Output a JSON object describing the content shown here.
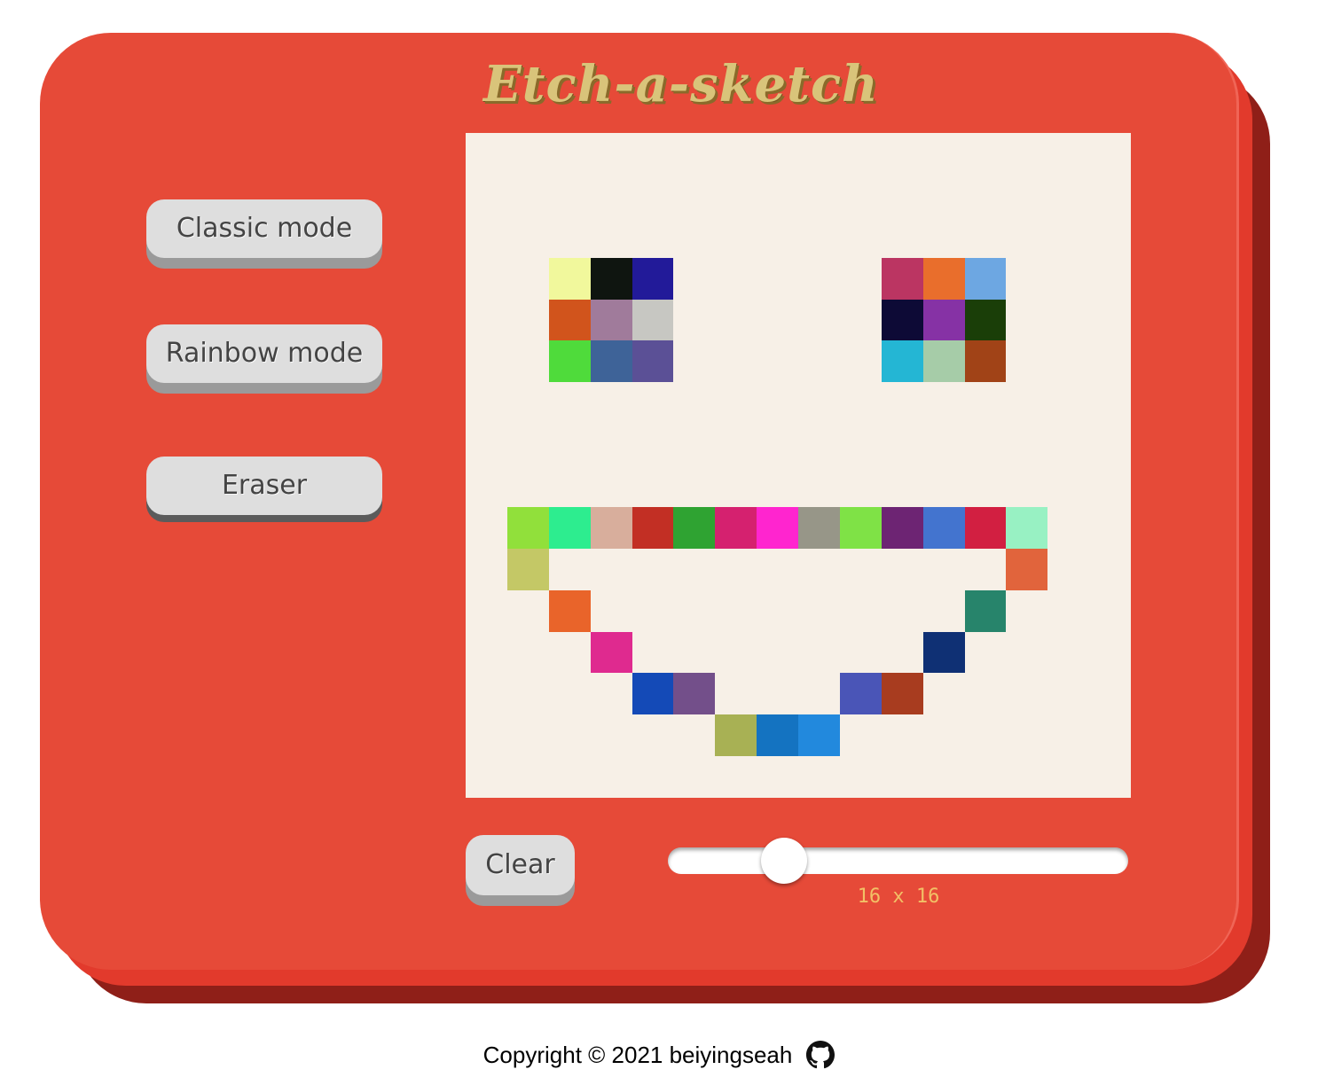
{
  "title": "Etch-a-sketch",
  "buttons": {
    "classic": "Classic mode",
    "rainbow": "Rainbow mode",
    "eraser": "Eraser",
    "clear": "Clear"
  },
  "slider": {
    "value": 16,
    "min": 2,
    "max": 64,
    "label": "16 x 16"
  },
  "footer": {
    "copyright": "Copyright © 2021 beiyingseah",
    "icon": "github-icon"
  },
  "colors": {
    "frame": "#e64a38",
    "frame_shadow": "#8f1f18",
    "board_bg": "#f7f0e7",
    "title": "#d9c47a",
    "label": "#f2c066"
  },
  "grid": {
    "size": 16,
    "painted": [
      {
        "r": 3,
        "c": 2,
        "color": "#f1f89c"
      },
      {
        "r": 3,
        "c": 3,
        "color": "#0f1510"
      },
      {
        "r": 3,
        "c": 4,
        "color": "#221a99"
      },
      {
        "r": 4,
        "c": 2,
        "color": "#d1541c"
      },
      {
        "r": 4,
        "c": 3,
        "color": "#a07b9b"
      },
      {
        "r": 4,
        "c": 4,
        "color": "#c7c7c2"
      },
      {
        "r": 5,
        "c": 2,
        "color": "#4fdb3b"
      },
      {
        "r": 5,
        "c": 3,
        "color": "#3e6398"
      },
      {
        "r": 5,
        "c": 4,
        "color": "#5b5096"
      },
      {
        "r": 3,
        "c": 10,
        "color": "#bb3562"
      },
      {
        "r": 3,
        "c": 11,
        "color": "#e96e2c"
      },
      {
        "r": 3,
        "c": 12,
        "color": "#6da7e2"
      },
      {
        "r": 4,
        "c": 10,
        "color": "#0d0a36"
      },
      {
        "r": 4,
        "c": 11,
        "color": "#8632a5"
      },
      {
        "r": 4,
        "c": 12,
        "color": "#1a3e08"
      },
      {
        "r": 5,
        "c": 10,
        "color": "#24b6d4"
      },
      {
        "r": 5,
        "c": 11,
        "color": "#a6cca8"
      },
      {
        "r": 5,
        "c": 12,
        "color": "#a14317"
      },
      {
        "r": 9,
        "c": 1,
        "color": "#91e03b"
      },
      {
        "r": 9,
        "c": 2,
        "color": "#2ded8f"
      },
      {
        "r": 9,
        "c": 3,
        "color": "#d8ae9c"
      },
      {
        "r": 9,
        "c": 4,
        "color": "#c22f24"
      },
      {
        "r": 9,
        "c": 5,
        "color": "#2fa332"
      },
      {
        "r": 9,
        "c": 6,
        "color": "#d5216f"
      },
      {
        "r": 9,
        "c": 7,
        "color": "#ff25cf"
      },
      {
        "r": 9,
        "c": 8,
        "color": "#979688"
      },
      {
        "r": 9,
        "c": 9,
        "color": "#7fe246"
      },
      {
        "r": 9,
        "c": 10,
        "color": "#6d2473"
      },
      {
        "r": 9,
        "c": 11,
        "color": "#4374cf"
      },
      {
        "r": 9,
        "c": 12,
        "color": "#d21f41"
      },
      {
        "r": 9,
        "c": 13,
        "color": "#98f1c3"
      },
      {
        "r": 10,
        "c": 1,
        "color": "#c4c866"
      },
      {
        "r": 10,
        "c": 13,
        "color": "#e1643c"
      },
      {
        "r": 11,
        "c": 2,
        "color": "#e9642a"
      },
      {
        "r": 11,
        "c": 12,
        "color": "#27846b"
      },
      {
        "r": 12,
        "c": 3,
        "color": "#df2a8f"
      },
      {
        "r": 12,
        "c": 11,
        "color": "#0f3074"
      },
      {
        "r": 13,
        "c": 4,
        "color": "#144ab7"
      },
      {
        "r": 13,
        "c": 5,
        "color": "#734f8a"
      },
      {
        "r": 13,
        "c": 9,
        "color": "#4a55b7"
      },
      {
        "r": 13,
        "c": 10,
        "color": "#a83c1f"
      },
      {
        "r": 14,
        "c": 6,
        "color": "#a8b154"
      },
      {
        "r": 14,
        "c": 7,
        "color": "#1473c1"
      },
      {
        "r": 14,
        "c": 8,
        "color": "#2289dd"
      }
    ]
  }
}
